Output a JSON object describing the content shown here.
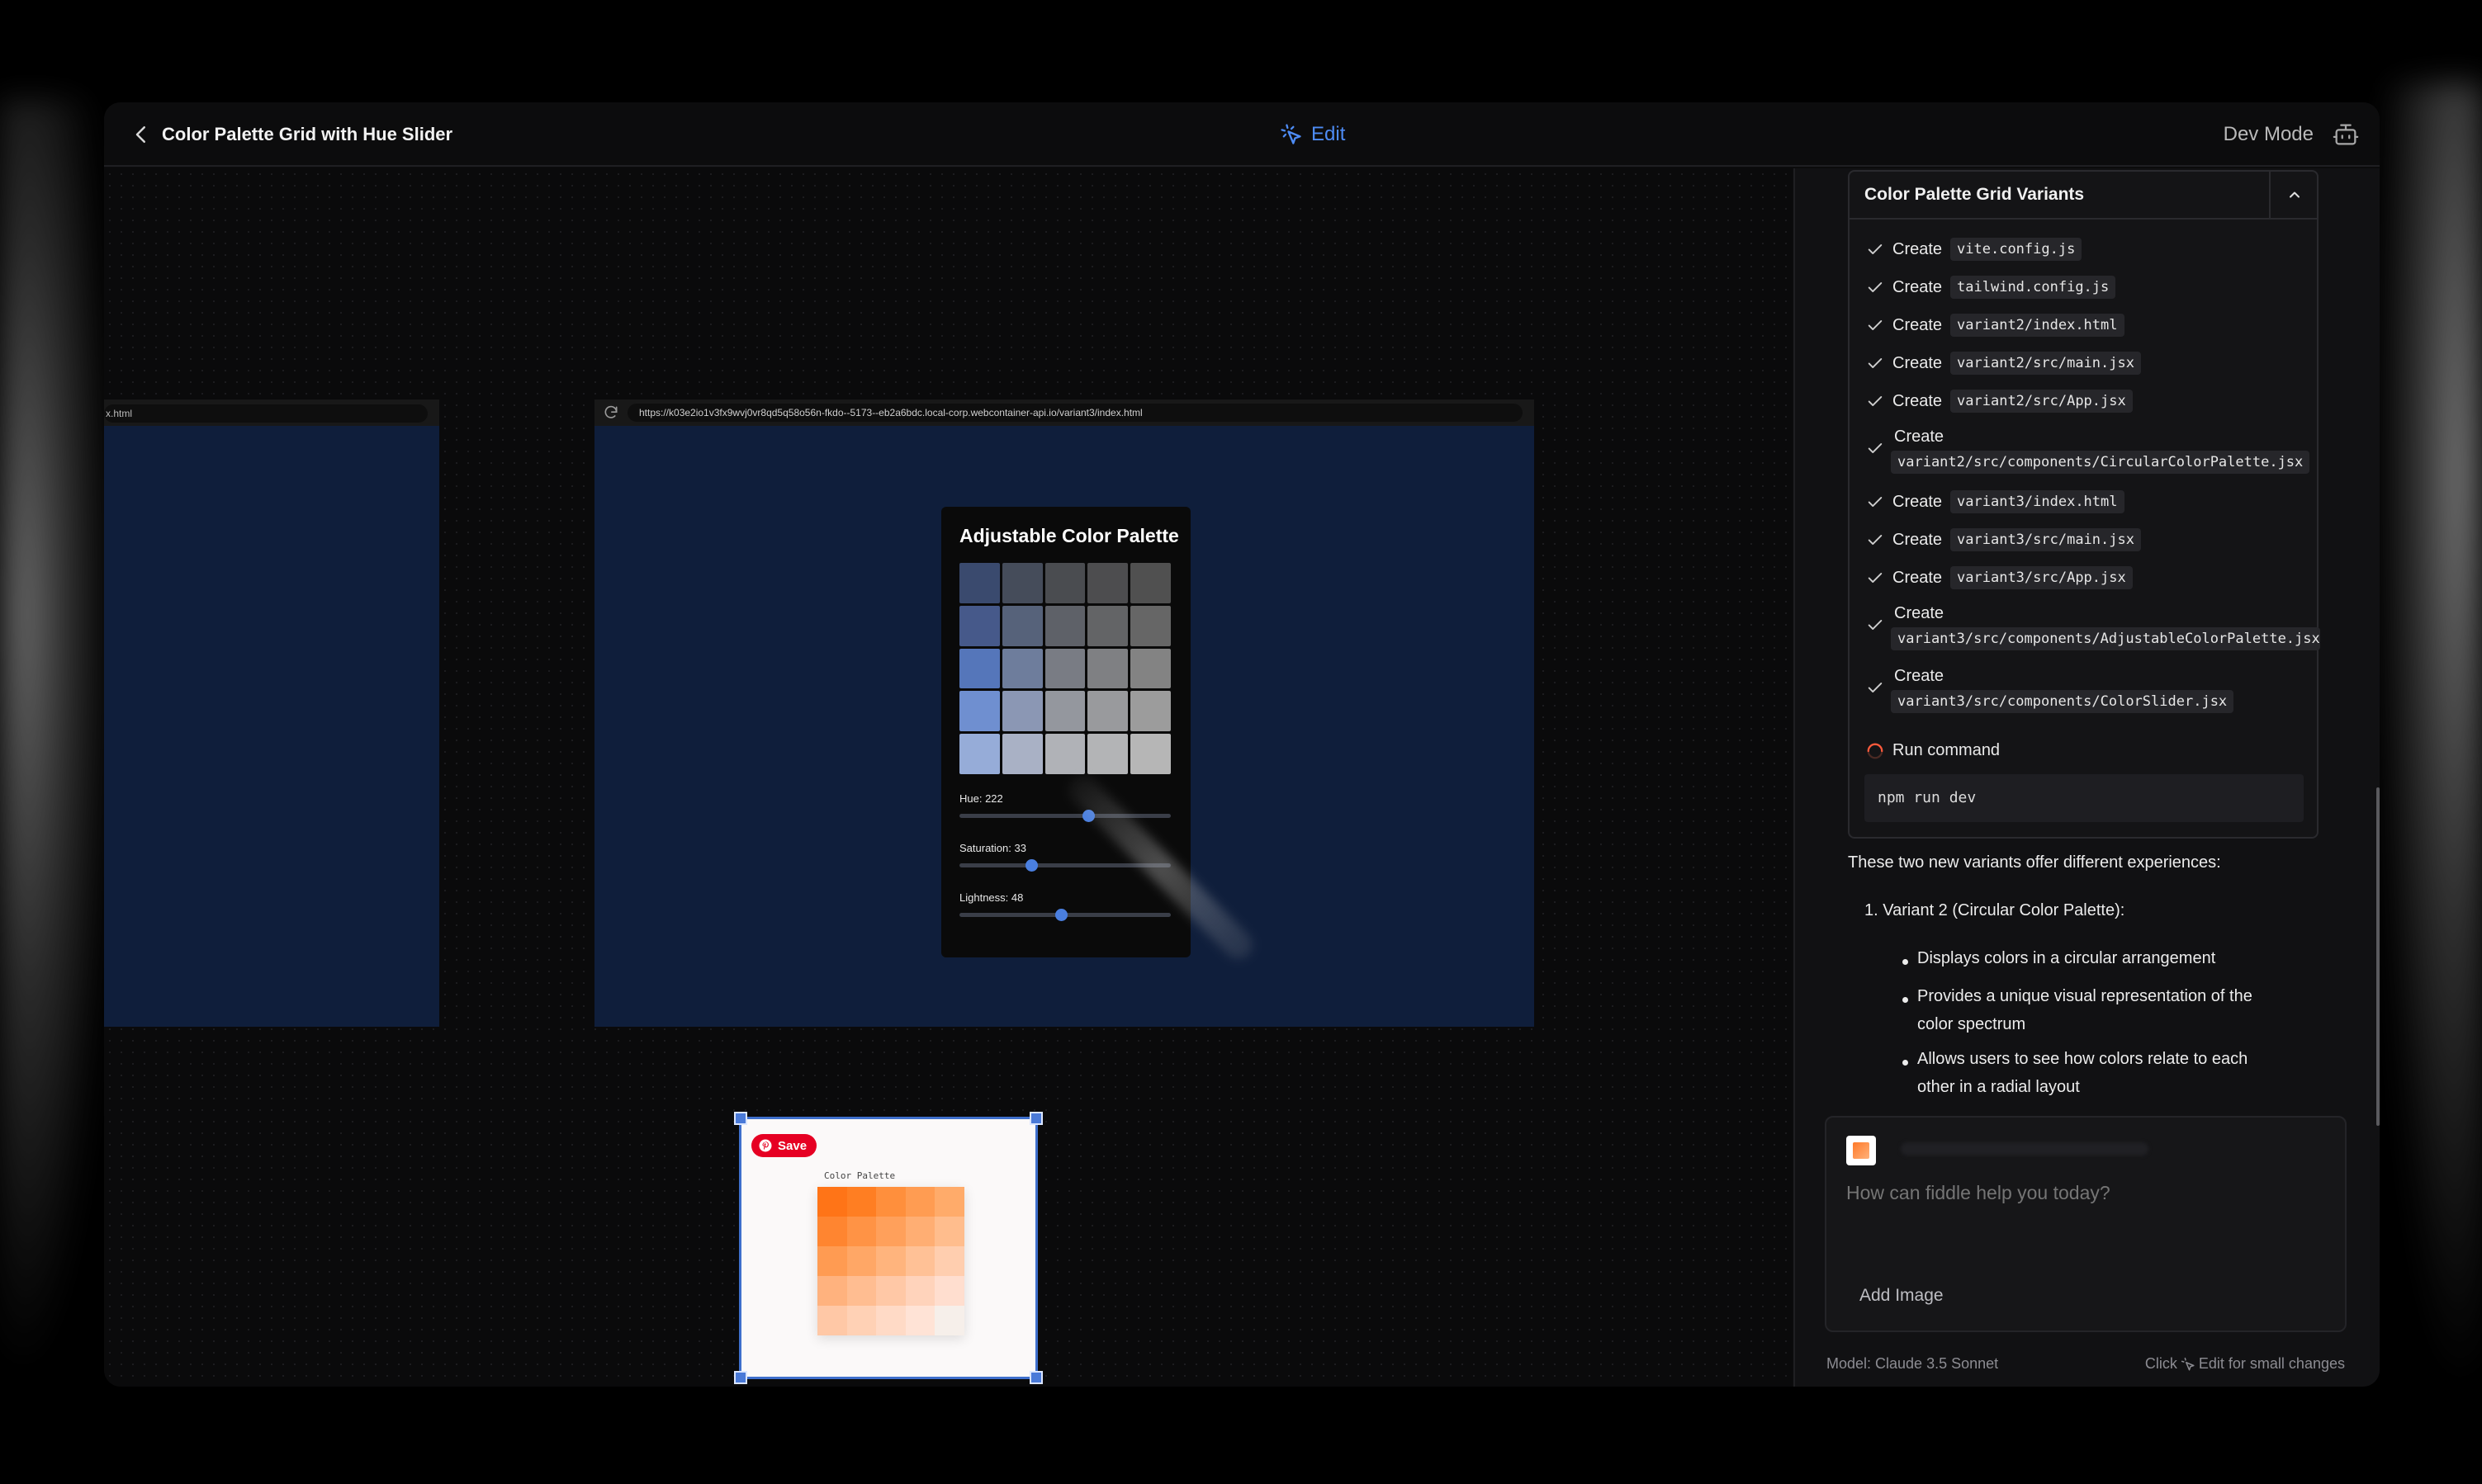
{
  "header": {
    "title": "Color Palette Grid with Hue Slider",
    "edit_label": "Edit",
    "dev_mode_label": "Dev Mode"
  },
  "preview": {
    "frame1_url": "x.html",
    "frame2_url": "https://k03e2io1v3fx9wvj0vr8qd5q58o56n-fkdo--5173--eb2a6bdc.local-corp.webcontainer-api.io/variant3/index.html",
    "palette": {
      "title": "Adjustable Color Palette",
      "hue_label": "Hue: 222",
      "hue_value": 222,
      "hue_max": 360,
      "saturation_label": "Saturation: 33",
      "saturation_value": 33,
      "lightness_label": "Lightness: 48",
      "lightness_value": 48,
      "grid_colors": [
        [
          "#3a4a6e",
          "#454c5a",
          "#4a4c50",
          "#4d4d4f",
          "#505050"
        ],
        [
          "#46598a",
          "#56627a",
          "#5e6168",
          "#636466",
          "#666666"
        ],
        [
          "#5576ba",
          "#6e7d9c",
          "#797c84",
          "#7f8083",
          "#838383"
        ],
        [
          "#6f8fd0",
          "#8b97b4",
          "#94979e",
          "#999a9d",
          "#9c9c9c"
        ],
        [
          "#96acd8",
          "#a9b1c5",
          "#b0b2b7",
          "#b3b4b6",
          "#b6b6b6"
        ]
      ]
    },
    "image_card": {
      "save_label": "Save",
      "mini_title": "Color Palette",
      "mini_colors": [
        [
          "#ff7417",
          "#ff7e22",
          "#ff8f3c",
          "#ff9c52",
          "#ffab6a"
        ],
        [
          "#ff8530",
          "#ff9345",
          "#ffa05b",
          "#ffae73",
          "#ffbd8d"
        ],
        [
          "#ff9b52",
          "#ffa766",
          "#ffb47d",
          "#ffc196",
          "#ffceaf"
        ],
        [
          "#ffb27e",
          "#ffbd91",
          "#ffc8a6",
          "#ffd3bb",
          "#ffdecf"
        ],
        [
          "#ffc8a6",
          "#ffd1b5",
          "#ffdac6",
          "#ffe3d6",
          "#f6efea"
        ]
      ]
    }
  },
  "panel": {
    "steps_title": "Color Palette Grid Variants",
    "steps": [
      {
        "verb": "Create",
        "file": "vite.config.js"
      },
      {
        "verb": "Create",
        "file": "tailwind.config.js"
      },
      {
        "verb": "Create",
        "file": "variant2/index.html"
      },
      {
        "verb": "Create",
        "file": "variant2/src/main.jsx"
      },
      {
        "verb": "Create",
        "file": "variant2/src/App.jsx"
      },
      {
        "verb": "Create",
        "file": "variant2/src/components/CircularColorPalette.jsx"
      },
      {
        "verb": "Create",
        "file": "variant3/index.html"
      },
      {
        "verb": "Create",
        "file": "variant3/src/main.jsx"
      },
      {
        "verb": "Create",
        "file": "variant3/src/App.jsx"
      },
      {
        "verb": "Create",
        "file": "variant3/src/components/AdjustableColorPalette.jsx"
      },
      {
        "verb": "Create",
        "file": "variant3/src/components/ColorSlider.jsx"
      }
    ],
    "run_label": "Run command",
    "command": "npm run dev",
    "message": {
      "intro": "These two new variants offer different experiences:",
      "item1": "1. Variant 2 (Circular Color Palette):",
      "bullets": [
        "Displays colors in a circular arrangement",
        "Provides a unique visual representation of the",
        "color spectrum",
        "Allows users to see how colors relate to each",
        "other in a radial layout"
      ]
    },
    "composer": {
      "placeholder": "How can fiddle help you today?",
      "add_image_label": "Add Image"
    },
    "footer": {
      "model": "Model: Claude 3.5 Sonnet",
      "hint_prefix": "Click",
      "hint_suffix": "Edit for small changes"
    }
  },
  "colors": {
    "accent": "#4e8cf5",
    "preview_bg": "#0f1e3b",
    "pinterest": "#e60023",
    "spinner": "#ff5a3c"
  }
}
